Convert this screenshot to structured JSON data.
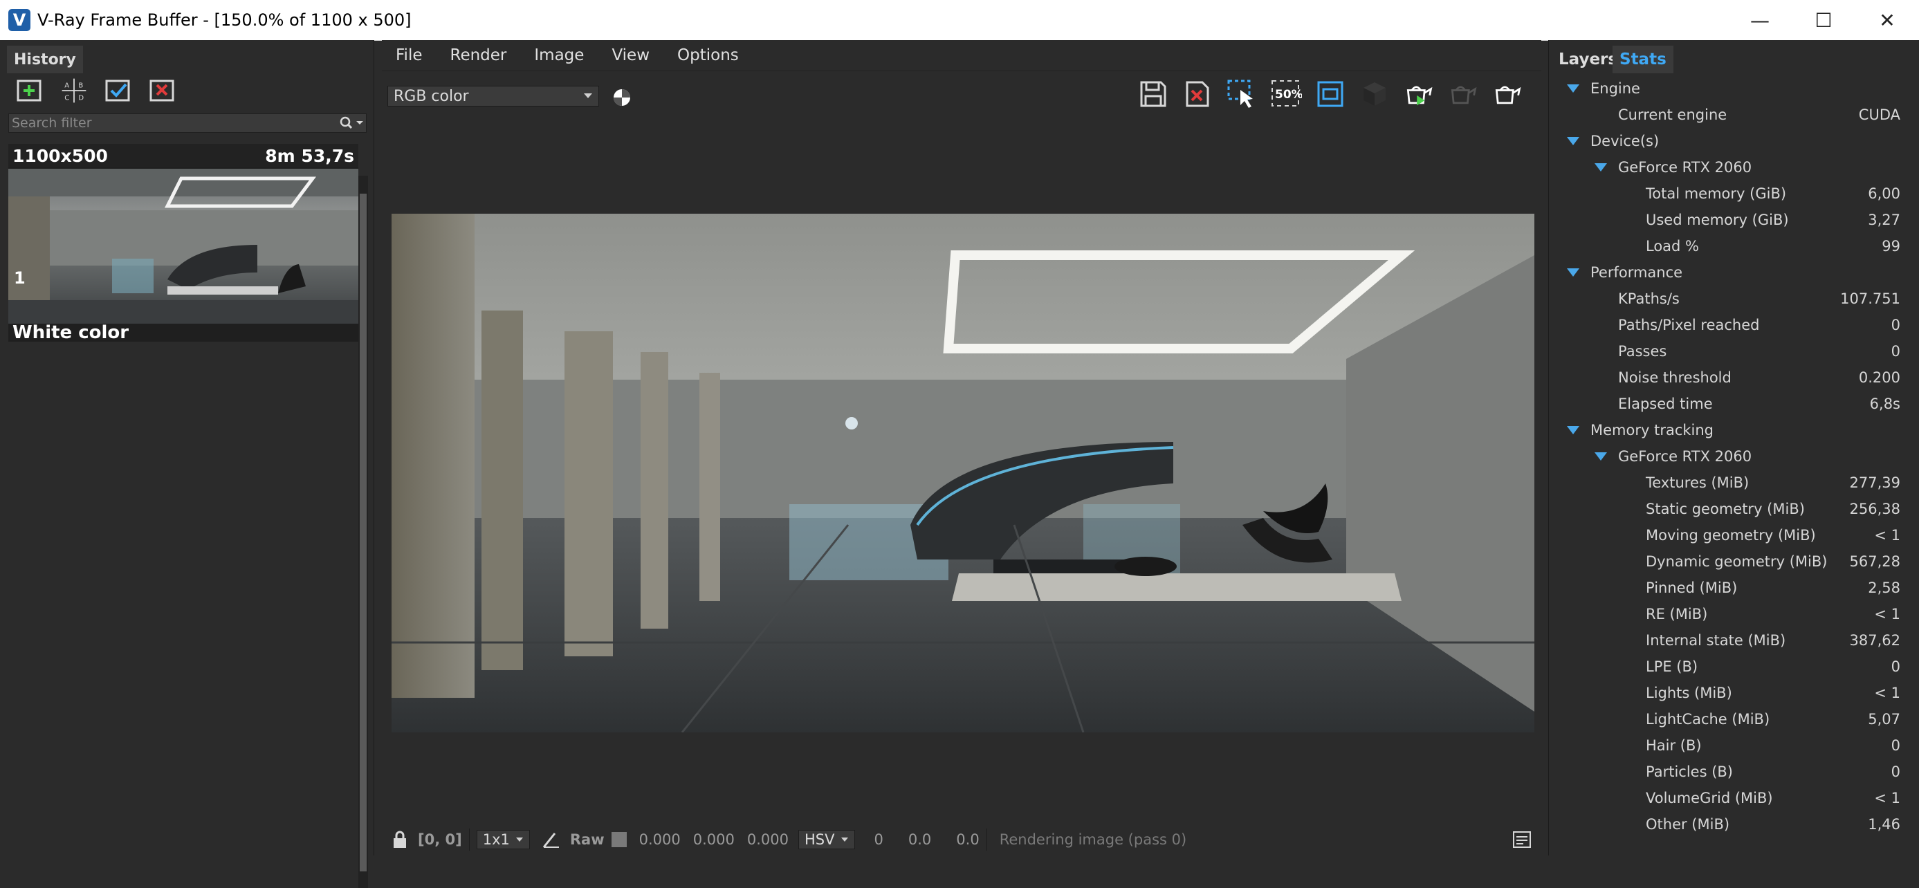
{
  "window": {
    "title": "V-Ray Frame Buffer - [150.0% of 1100 x 500]",
    "logo": "V",
    "controls": [
      "—",
      "☐",
      "✕"
    ]
  },
  "history": {
    "tab_label": "History",
    "search_placeholder": "Search filter",
    "item": {
      "resolution": "1100x500",
      "time": "8m 53,7s",
      "index": "1",
      "label": "White color"
    }
  },
  "menu": [
    "File",
    "Render",
    "Image",
    "View",
    "Options"
  ],
  "toolbar": {
    "channel": "RGB color",
    "zoom_badge": "50%"
  },
  "statusbar": {
    "coords": "[0, 0]",
    "sampling": "1x1",
    "raw_label": "Raw",
    "rgb": [
      "0.000",
      "0.000",
      "0.000"
    ],
    "color_mode": "HSV",
    "hsv": [
      "0",
      "0.0",
      "0.0"
    ],
    "message": "Rendering image (pass 0)"
  },
  "stats": {
    "tab_layers": "Layers",
    "tab_stats": "Stats",
    "rows": [
      {
        "label": "Engine",
        "value": "",
        "level": 0,
        "expand": true
      },
      {
        "label": "Current engine",
        "value": "CUDA",
        "level": 1
      },
      {
        "label": "Device(s)",
        "value": "",
        "level": 0,
        "expand": true
      },
      {
        "label": "GeForce RTX 2060",
        "value": "",
        "level": 1,
        "expand": true
      },
      {
        "label": "Total memory (GiB)",
        "value": "6,00",
        "level": 2
      },
      {
        "label": "Used memory (GiB)",
        "value": "3,27",
        "level": 2
      },
      {
        "label": "Load %",
        "value": "99",
        "level": 2
      },
      {
        "label": "Performance",
        "value": "",
        "level": 0,
        "expand": true
      },
      {
        "label": "KPaths/s",
        "value": "107.751",
        "level": 1
      },
      {
        "label": "Paths/Pixel reached",
        "value": "0",
        "level": 1
      },
      {
        "label": "Passes",
        "value": "0",
        "level": 1
      },
      {
        "label": "Noise threshold",
        "value": "0.200",
        "level": 1
      },
      {
        "label": "Elapsed time",
        "value": "6,8s",
        "level": 1
      },
      {
        "label": "Memory tracking",
        "value": "",
        "level": 0,
        "expand": true
      },
      {
        "label": "GeForce RTX 2060",
        "value": "",
        "level": 1,
        "expand": true
      },
      {
        "label": "Textures (MiB)",
        "value": "277,39",
        "level": 2
      },
      {
        "label": "Static geometry (MiB)",
        "value": "256,38",
        "level": 2
      },
      {
        "label": "Moving geometry (MiB)",
        "value": "< 1",
        "level": 2
      },
      {
        "label": "Dynamic geometry (MiB)",
        "value": "567,28",
        "level": 2
      },
      {
        "label": "Pinned (MiB)",
        "value": "2,58",
        "level": 2
      },
      {
        "label": "RE (MiB)",
        "value": "< 1",
        "level": 2
      },
      {
        "label": "Internal state (MiB)",
        "value": "387,62",
        "level": 2
      },
      {
        "label": "LPE (B)",
        "value": "0",
        "level": 2
      },
      {
        "label": "Lights (MiB)",
        "value": "< 1",
        "level": 2
      },
      {
        "label": "LightCache (MiB)",
        "value": "5,07",
        "level": 2
      },
      {
        "label": "Hair (B)",
        "value": "0",
        "level": 2
      },
      {
        "label": "Particles (B)",
        "value": "0",
        "level": 2
      },
      {
        "label": "VolumeGrid (MiB)",
        "value": "< 1",
        "level": 2
      },
      {
        "label": "Other (MiB)",
        "value": "1,46",
        "level": 2
      }
    ]
  }
}
